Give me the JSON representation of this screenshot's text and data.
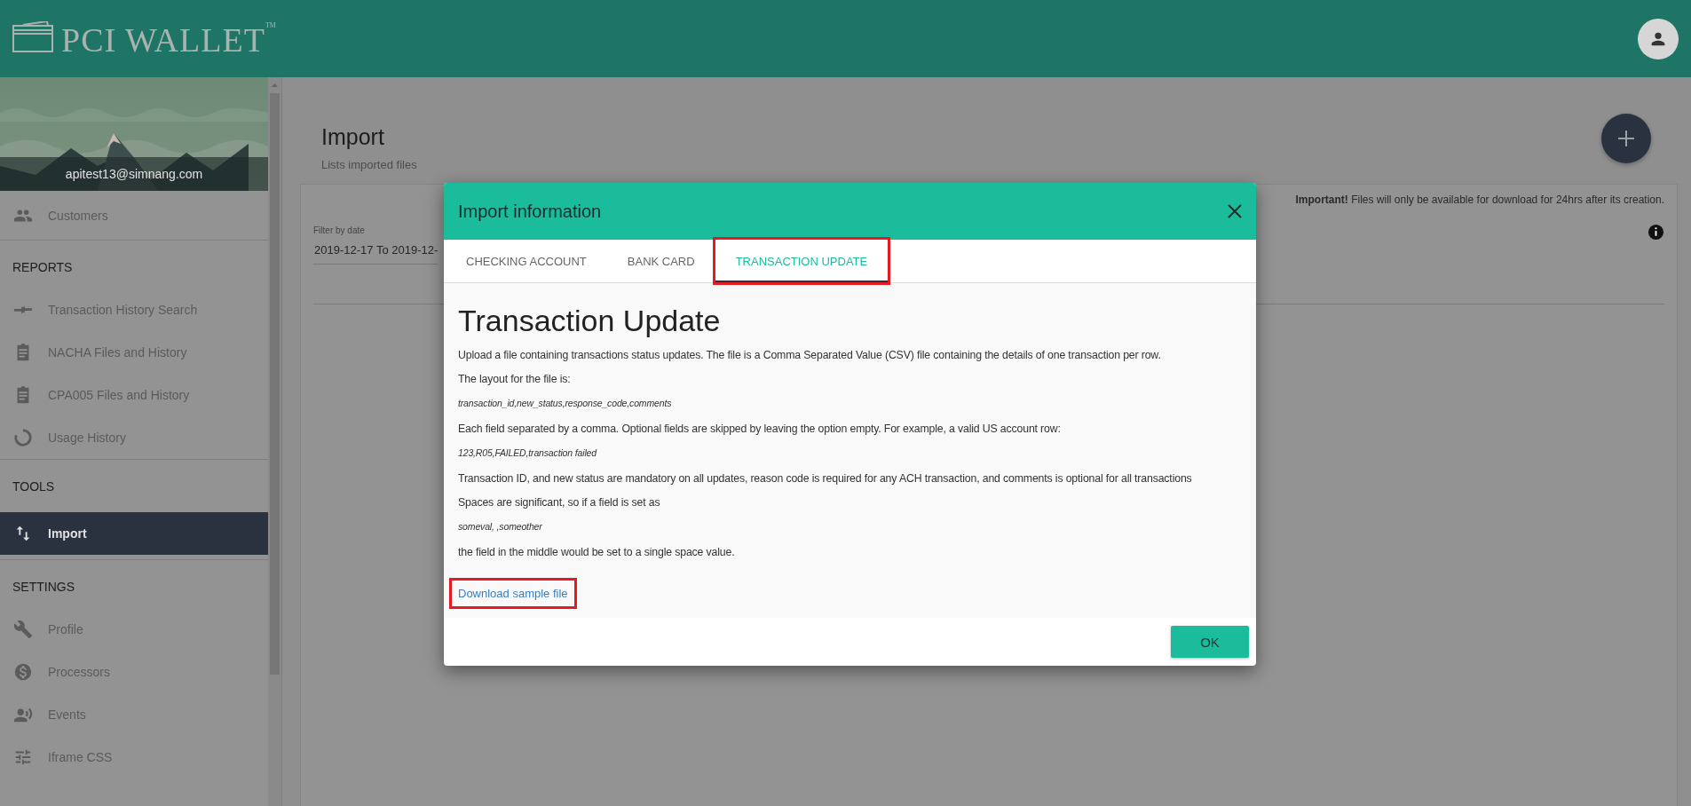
{
  "header": {
    "logo_text": "PCI WALLET",
    "trademark": "TM"
  },
  "sidebar": {
    "user_email": "apitest13@simnang.com",
    "groups": [
      {
        "items": [
          {
            "label": "Customers",
            "selected": false
          }
        ]
      },
      {
        "heading": "REPORTS",
        "items": [
          {
            "label": "Transaction History Search",
            "selected": false
          },
          {
            "label": "NACHA Files and History",
            "selected": false
          },
          {
            "label": "CPA005 Files and History",
            "selected": false
          },
          {
            "label": "Usage History",
            "selected": false
          }
        ]
      },
      {
        "heading": "TOOLS",
        "items": [
          {
            "label": "Import",
            "selected": true
          }
        ]
      },
      {
        "heading": "SETTINGS",
        "items": [
          {
            "label": "Profile",
            "selected": false
          },
          {
            "label": "Processors",
            "selected": false
          },
          {
            "label": "Events",
            "selected": false
          },
          {
            "label": "Iframe CSS",
            "selected": false
          }
        ]
      }
    ]
  },
  "main": {
    "title": "Import",
    "subtitle": "Lists imported files",
    "notice": "**Important!** Files will only be available for download for 24hrs after its creation.",
    "filter": {
      "label": "Filter by date",
      "value": "2019-12-17 To 2019-12-"
    }
  },
  "modal": {
    "title": "Import information",
    "tabs": [
      {
        "label": "CHECKING ACCOUNT",
        "selected": false,
        "highlighted": false
      },
      {
        "label": "BANK CARD",
        "selected": false,
        "highlighted": false
      },
      {
        "label": "TRANSACTION UPDATE",
        "selected": true,
        "highlighted": true
      }
    ],
    "heading": "Transaction Update",
    "paragraphs": [
      {
        "kind": "text",
        "text": "Upload a file containing transactions status updates. The file is a Comma Separated Value (CSV) file containing the details of one transaction per row."
      },
      {
        "kind": "text",
        "text": "The layout for the file is:"
      },
      {
        "kind": "code",
        "text": "transaction_id,new_status,response_code,comments"
      },
      {
        "kind": "text",
        "text": "Each field separated by a comma. Optional fields are skipped by leaving the option empty. For example, a valid US account row:"
      },
      {
        "kind": "code",
        "text": "123,R05,FAILED,transaction failed"
      },
      {
        "kind": "text",
        "text": "Transaction ID, and new status are mandatory on all updates, reason code is required for any ACH transaction, and comments is optional for all transactions"
      },
      {
        "kind": "text",
        "text": "Spaces are significant, so if a field is set as"
      },
      {
        "kind": "code",
        "text": "someval, ,someother"
      },
      {
        "kind": "text",
        "text": "the field in the middle would be set to a single space value."
      }
    ],
    "link": {
      "label": "Download sample file",
      "highlighted": true
    },
    "button": "OK"
  }
}
